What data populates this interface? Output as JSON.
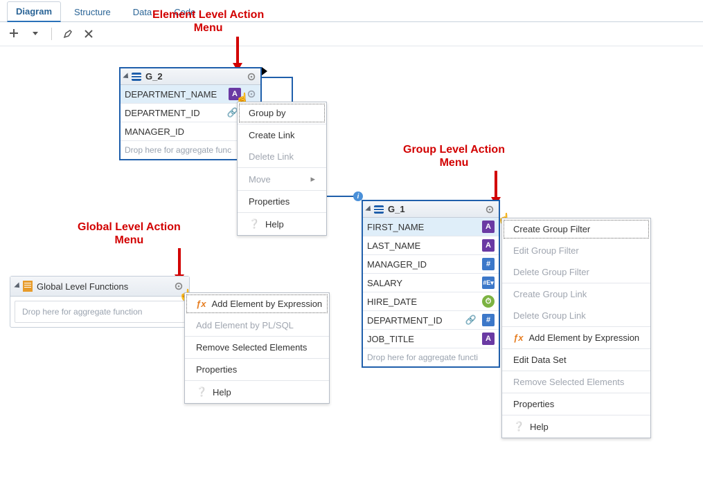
{
  "annotations": {
    "element": "Element Level Action\nMenu",
    "group": "Group Level Action\nMenu",
    "global": "Global Level Action\nMenu"
  },
  "tabs": [
    {
      "id": "diagram",
      "label": "Diagram",
      "active": true
    },
    {
      "id": "structure",
      "label": "Structure",
      "active": false
    },
    {
      "id": "data",
      "label": "Data",
      "active": false
    },
    {
      "id": "code",
      "label": "Code",
      "active": false
    }
  ],
  "group_g2": {
    "title": "G_2",
    "fields": [
      {
        "name": "DEPARTMENT_NAME",
        "type": "A",
        "link": false,
        "selected": true,
        "show_gear": true
      },
      {
        "name": "DEPARTMENT_ID",
        "type": "H",
        "link": true,
        "selected": false,
        "show_gear": false
      },
      {
        "name": "MANAGER_ID",
        "type": "H",
        "link": false,
        "selected": false,
        "show_gear": false
      }
    ],
    "drop": "Drop here for aggregate func"
  },
  "element_menu": [
    {
      "label": "Group by",
      "kind": "normal",
      "selected": true
    },
    {
      "label": "Create Link",
      "kind": "normal"
    },
    {
      "label": "Delete Link",
      "kind": "disabled"
    },
    {
      "label": "Move",
      "kind": "disabled",
      "sub": true
    },
    {
      "label": "Properties",
      "kind": "normal"
    },
    {
      "label": "Help",
      "kind": "help"
    }
  ],
  "group_g1": {
    "title": "G_1",
    "fields": [
      {
        "name": "FIRST_NAME",
        "type": "A",
        "selected": true
      },
      {
        "name": "LAST_NAME",
        "type": "A"
      },
      {
        "name": "MANAGER_ID",
        "type": "H"
      },
      {
        "name": "SALARY",
        "type": "EV"
      },
      {
        "name": "HIRE_DATE",
        "type": "CLOCK"
      },
      {
        "name": "DEPARTMENT_ID",
        "type": "H",
        "link": true
      },
      {
        "name": "JOB_TITLE",
        "type": "A"
      }
    ],
    "drop": "Drop here for aggregate functi"
  },
  "group_menu": [
    {
      "label": "Create Group Filter",
      "kind": "normal",
      "selected": true
    },
    {
      "label": "Edit Group Filter",
      "kind": "disabled"
    },
    {
      "label": "Delete Group Filter",
      "kind": "disabled"
    },
    {
      "label": "Create Group Link",
      "kind": "disabled"
    },
    {
      "label": "Delete Group Link",
      "kind": "disabled"
    },
    {
      "label": "Add Element by Expression",
      "kind": "fx"
    },
    {
      "label": "Edit Data Set",
      "kind": "normal"
    },
    {
      "label": "Remove Selected Elements",
      "kind": "disabled"
    },
    {
      "label": "Properties",
      "kind": "normal"
    },
    {
      "label": "Help",
      "kind": "help"
    }
  ],
  "global_box": {
    "title": "Global Level Functions",
    "drop": "Drop here for aggregate function"
  },
  "global_menu": [
    {
      "label": "Add Element by Expression",
      "kind": "fx",
      "selected": true
    },
    {
      "label": "Add Element by PL/SQL",
      "kind": "disabled"
    },
    {
      "label": "Remove Selected Elements",
      "kind": "normal"
    },
    {
      "label": "Properties",
      "kind": "normal"
    },
    {
      "label": "Help",
      "kind": "help"
    }
  ]
}
